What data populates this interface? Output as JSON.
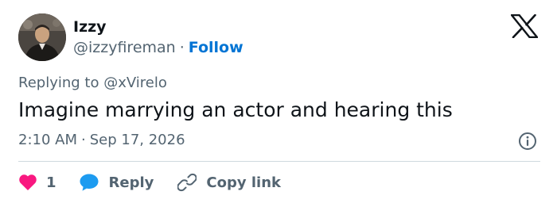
{
  "author": {
    "name": "Izzy",
    "handle": "@izzyfireman",
    "separator": "·",
    "follow_label": "Follow",
    "avatar_icon": "profile-photo"
  },
  "platform_icon": "x-logo-icon",
  "reply_context": {
    "prefix": "Replying to",
    "mention": "@xVirelo"
  },
  "tweet": {
    "text": "Imagine marrying an actor and hearing this",
    "time": "2:10 AM",
    "separator": "·",
    "date": "Sep 17, 2026"
  },
  "actions": {
    "like_count": "1",
    "reply_label": "Reply",
    "copy_link_label": "Copy link"
  },
  "colors": {
    "text_primary": "#0f1419",
    "text_secondary": "#536471",
    "follow_blue": "#0074d4",
    "like_pink": "#f91880",
    "reply_blue": "#1d9bf0",
    "divider": "#cfd9de"
  }
}
